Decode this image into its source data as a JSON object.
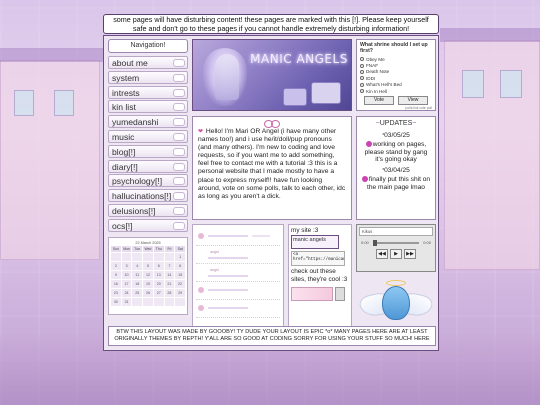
{
  "banner": {
    "text": "some pages will have disturbing content! these pages are marked with this [!]. Please keep yourself safe and don't go to these pages if you cannot handle extremely disturbing information!"
  },
  "nav": {
    "title": "Navigation!",
    "items": [
      {
        "label": "about me"
      },
      {
        "label": "system"
      },
      {
        "label": "intrests"
      },
      {
        "label": "kin list"
      },
      {
        "label": "yumedanshi"
      },
      {
        "label": "music"
      },
      {
        "label": "blog[!]"
      },
      {
        "label": "diary[!]"
      },
      {
        "label": "psychology[!]"
      },
      {
        "label": "hallucinations[!]"
      },
      {
        "label": "delusions[!]"
      },
      {
        "label": "ocs[!]"
      }
    ]
  },
  "calendar": {
    "title": "22 March 2025",
    "weekdays": [
      "Sun",
      "Mon",
      "Tue",
      "Wed",
      "Thu",
      "Fri",
      "Sat"
    ],
    "days": [
      "",
      "",
      "",
      "",
      "",
      "",
      "1",
      "2",
      "3",
      "4",
      "5",
      "6",
      "7",
      "8",
      "9",
      "10",
      "11",
      "12",
      "13",
      "14",
      "15",
      "16",
      "17",
      "18",
      "19",
      "20",
      "21",
      "22",
      "23",
      "24",
      "25",
      "26",
      "27",
      "28",
      "29",
      "30",
      "31",
      "",
      "",
      "",
      "",
      ""
    ]
  },
  "header_image": {
    "title": "MANIC ANGELS"
  },
  "intro": {
    "text": "Hello! I'm Mari OR Angel (i have many other names too!) and i use he/it/doll/pup pronouns (and many others). I'm new to coding and love requests, so if you want me to add something, feel free to contact me with a tutorial :3 this is a personal website that I made mostly to have a place to express myself!! have fun looking around, vote on some polls, talk to each other, idc as long as you aren't a dick."
  },
  "chat": {
    "names": [
      "angel",
      "angel"
    ]
  },
  "site_button": {
    "label": "my site :3",
    "badge": "manic angels",
    "code": "<a href=\"https://manicang",
    "text": "check out these sites, they're cool :3"
  },
  "poll": {
    "question": "What shrine should I set up first?",
    "options": [
      "Obey Me",
      "FNAF",
      "Death Note",
      "IDDI",
      "What's Hell's Bed",
      "Kin In Hell"
    ],
    "vote_label": "Vote",
    "view_label": "View",
    "credit": "polls.link vote poll"
  },
  "updates": {
    "title": "UPDATES",
    "entries": [
      {
        "date": "03/05/25",
        "text": "working on pages, please stand by gang it's going okay"
      },
      {
        "date": "03/04/25",
        "text": "finally put this shit on the main page lmao"
      }
    ]
  },
  "player": {
    "track": "Kikus",
    "time_start": "0:00",
    "time_end": "0:00",
    "prev_label": "◀◀",
    "play_label": "▶",
    "next_label": "▶▶"
  },
  "footer": {
    "text": "BTW THIS LAYOUT WAS MADE BY GOOOBY! TY DUDE YOUR LAYOUT IS EPIC *o* MANY PAGES HERE ARE AT LEAST ORIGINALLY THEMES BY REPTH! Y'ALL ARE SO GOOD AT CODING SORRY FOR USING YOUR STUFF SO MUCH! HERE"
  },
  "colors": {
    "frame_border": "#6a4e80",
    "accent": "#cc44b0",
    "panel": "#efe6f3"
  }
}
